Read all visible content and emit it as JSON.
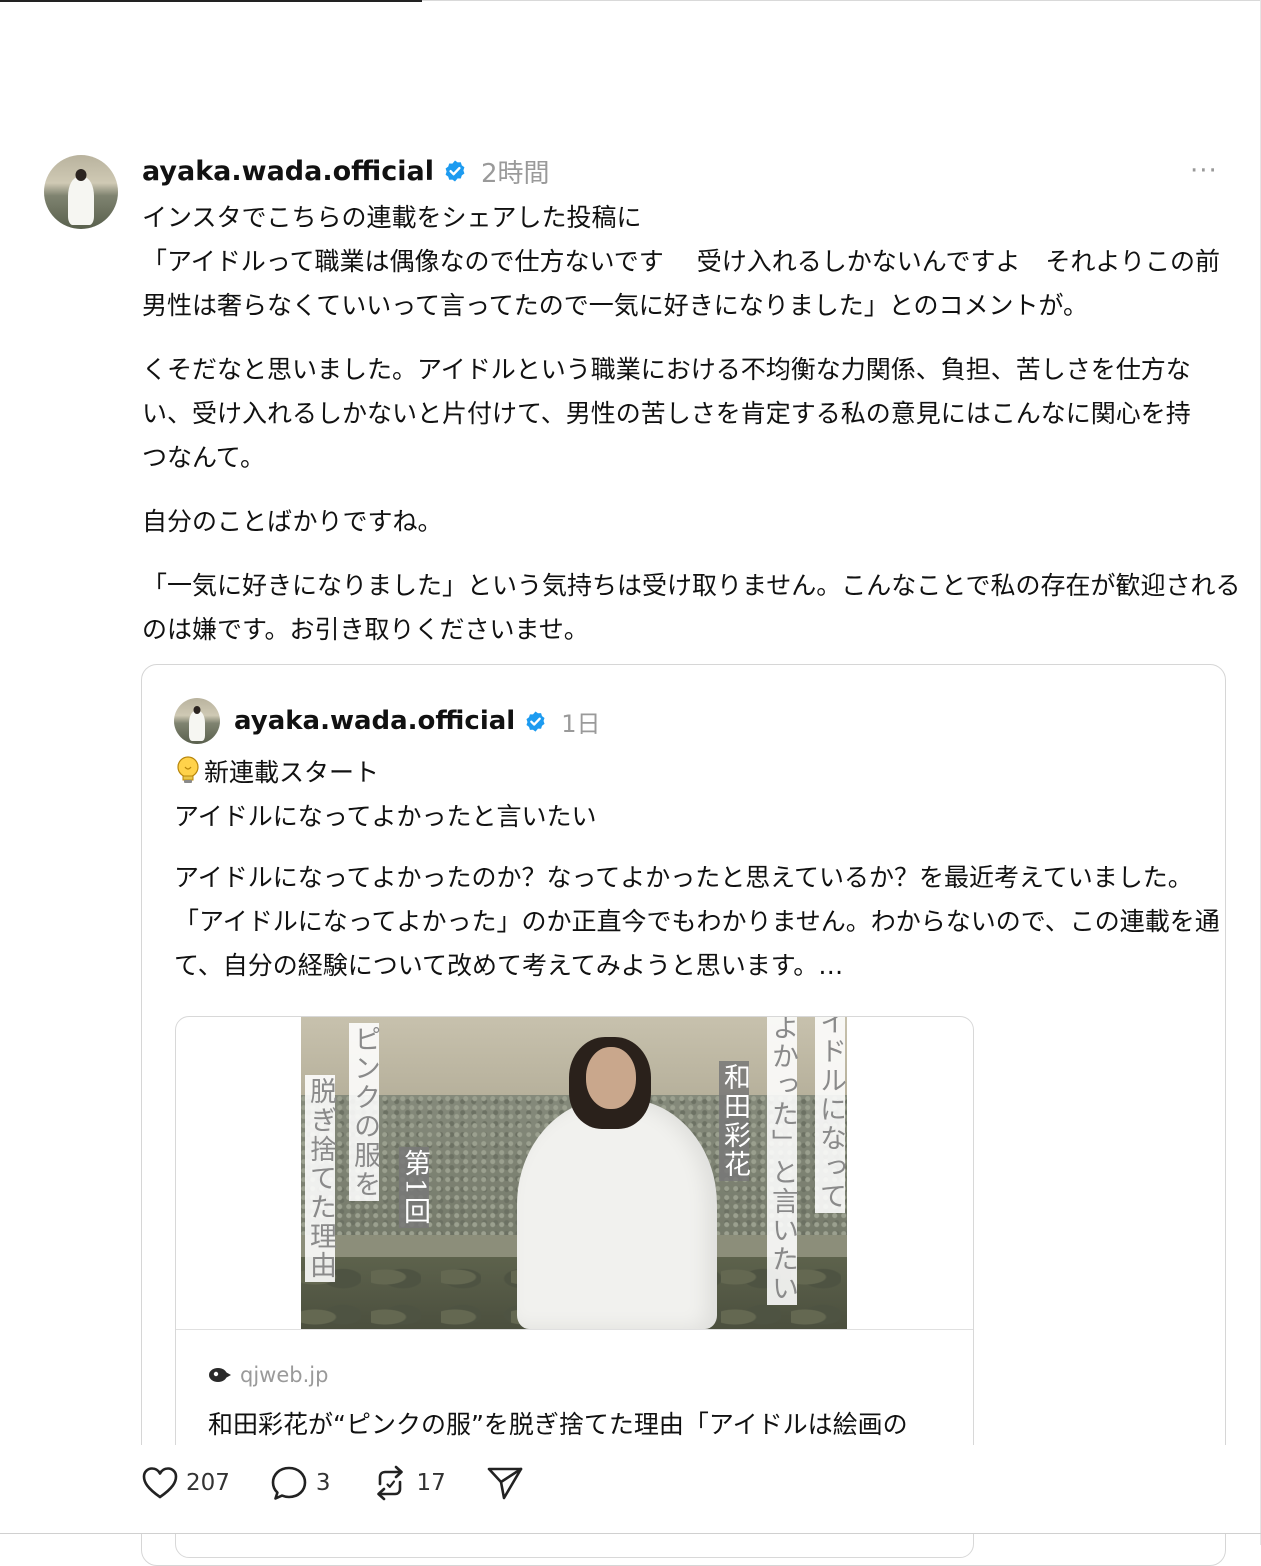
{
  "post": {
    "username": "ayaka.wada.official",
    "time": "2時間",
    "more": "···",
    "paragraphs": [
      {
        "lines": [
          "インスタでこちらの連載をシェアした投稿に",
          "「アイドルって職業は偶像なので仕方ないです　 受け入れるしかないんですよ　それよりこの前",
          "男性は奢らなくていいって言ってたので一気に好きになりました」とのコメントが。"
        ]
      },
      {
        "lines": [
          "くそだなと思いました。アイドルという職業における不均衡な力関係、負担、苦しさを仕方な",
          "い、受け入れるしかないと片付けて、男性の苦しさを肯定する私の意見にはこんなに関心を持",
          "つなんて。"
        ]
      },
      {
        "lines": [
          "自分のことばかりですね。"
        ]
      },
      {
        "lines": [
          "「一気に好きになりました」という気持ちは受け取りません。こんなことで私の存在が歓迎される",
          "のは嫌です。お引き取りくださいませ。"
        ]
      }
    ]
  },
  "quote": {
    "username": "ayaka.wada.official",
    "time": "1日",
    "paragraphs": [
      {
        "lines": [
          "新連載スタート",
          "アイドルになってよかったと言いたい"
        ]
      },
      {
        "lines": [
          "アイドルになってよかったのか？なってよかったと思えているか？を最近考えていました。",
          "「アイドルになってよかった」のか正直今でもわかりません。わからないので、この連載を通し",
          "て、自分の経験について改めて考えてみようと思います。…"
        ]
      }
    ],
    "link": {
      "image_labels": {
        "subtitle_line1": "ピンクの服を",
        "subtitle_line2": "脱ぎ捨てた理由",
        "episode": "第1回",
        "author": "和田彩花",
        "series_line1": "アイドルになって",
        "series_line2": "よかった」と言いたい"
      },
      "domain": "qjweb.jp",
      "title": "和田彩花が“ピンクの服”を脱ぎ捨てた理由「アイドルは絵画の"
    }
  },
  "actions": {
    "like_count": "207",
    "reply_count": "3",
    "repost_count": "17"
  },
  "colors": {
    "verified": "#1d9bf0",
    "muted": "#9a9a9a",
    "text": "#111111",
    "border": "#d6d6d6"
  },
  "icons": [
    "verified-badge-icon",
    "more-icon",
    "lightbulb-icon",
    "site-logo-icon",
    "heart-icon",
    "comment-icon",
    "repost-icon",
    "share-icon"
  ]
}
